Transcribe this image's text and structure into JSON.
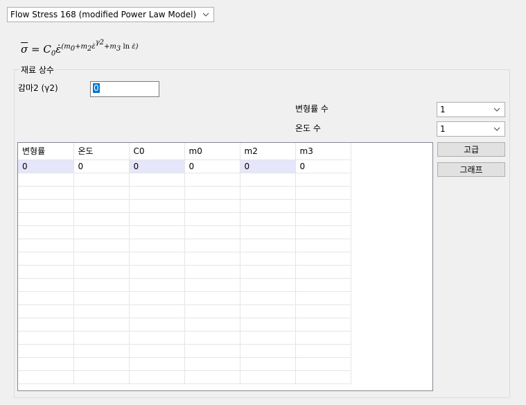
{
  "model_select": {
    "value": "Flow Stress 168 (modified Power Law Model)"
  },
  "formula": {
    "lhs": "σ",
    "equals": "=",
    "coef": "C",
    "coef_sub": "0",
    "base": "ε̇",
    "exp_open": "(m",
    "m0_sub": "0",
    "plus1": "+m",
    "m2_sub": "2",
    "exp_inner_base": "ε̇",
    "gamma": "γ2",
    "plus2": "+m",
    "m3_sub": "3",
    "ln": " ln ",
    "last_base": "ε̇",
    "exp_close": ")"
  },
  "group": {
    "title": "재료 상수",
    "gamma_label": "감마2 (γ2)",
    "gamma_value": "0",
    "strain_rate_count_label": "변형률 수",
    "strain_rate_count_value": "1",
    "temperature_count_label": "온도 수",
    "temperature_count_value": "1",
    "advanced_button": "고급",
    "graph_button": "그래프"
  },
  "table": {
    "columns": [
      "변형률",
      "온도",
      "C0",
      "m0",
      "m2",
      "m3"
    ],
    "rows": [
      [
        "0",
        "0",
        "0",
        "0",
        "0",
        "0"
      ]
    ],
    "highlight_columns": [
      0,
      2,
      4
    ]
  }
}
